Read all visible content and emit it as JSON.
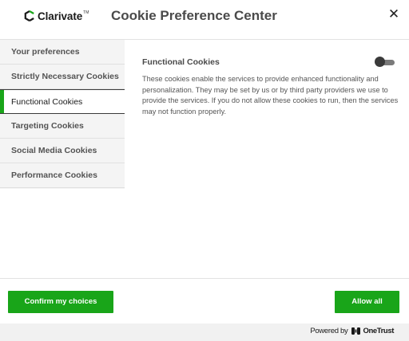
{
  "header": {
    "logo_text": "Clarivate",
    "logo_tm": "TM",
    "title": "Cookie Preference Center",
    "close_icon": "close-icon",
    "close_glyph": "✕"
  },
  "sidebar": {
    "items": [
      {
        "label": "Your preferences",
        "active": false
      },
      {
        "label": "Strictly Necessary Cookies",
        "active": false
      },
      {
        "label": "Functional Cookies",
        "active": true
      },
      {
        "label": "Targeting Cookies",
        "active": false
      },
      {
        "label": "Social Media Cookies",
        "active": false
      },
      {
        "label": "Performance Cookies",
        "active": false
      }
    ]
  },
  "content": {
    "section_title": "Functional Cookies",
    "toggle_state": "off",
    "description": "These cookies enable the services to provide enhanced functionality and personalization. They may be set by us or by third party providers we use to provide the services. If you do not allow these cookies to run, then the services may not function properly."
  },
  "footer": {
    "confirm_label": "Confirm my choices",
    "allow_label": "Allow all"
  },
  "powered": {
    "label": "Powered by",
    "brand": "OneTrust"
  },
  "colors": {
    "accent": "#19a519",
    "sidebar_bg": "#f4f4f4"
  }
}
